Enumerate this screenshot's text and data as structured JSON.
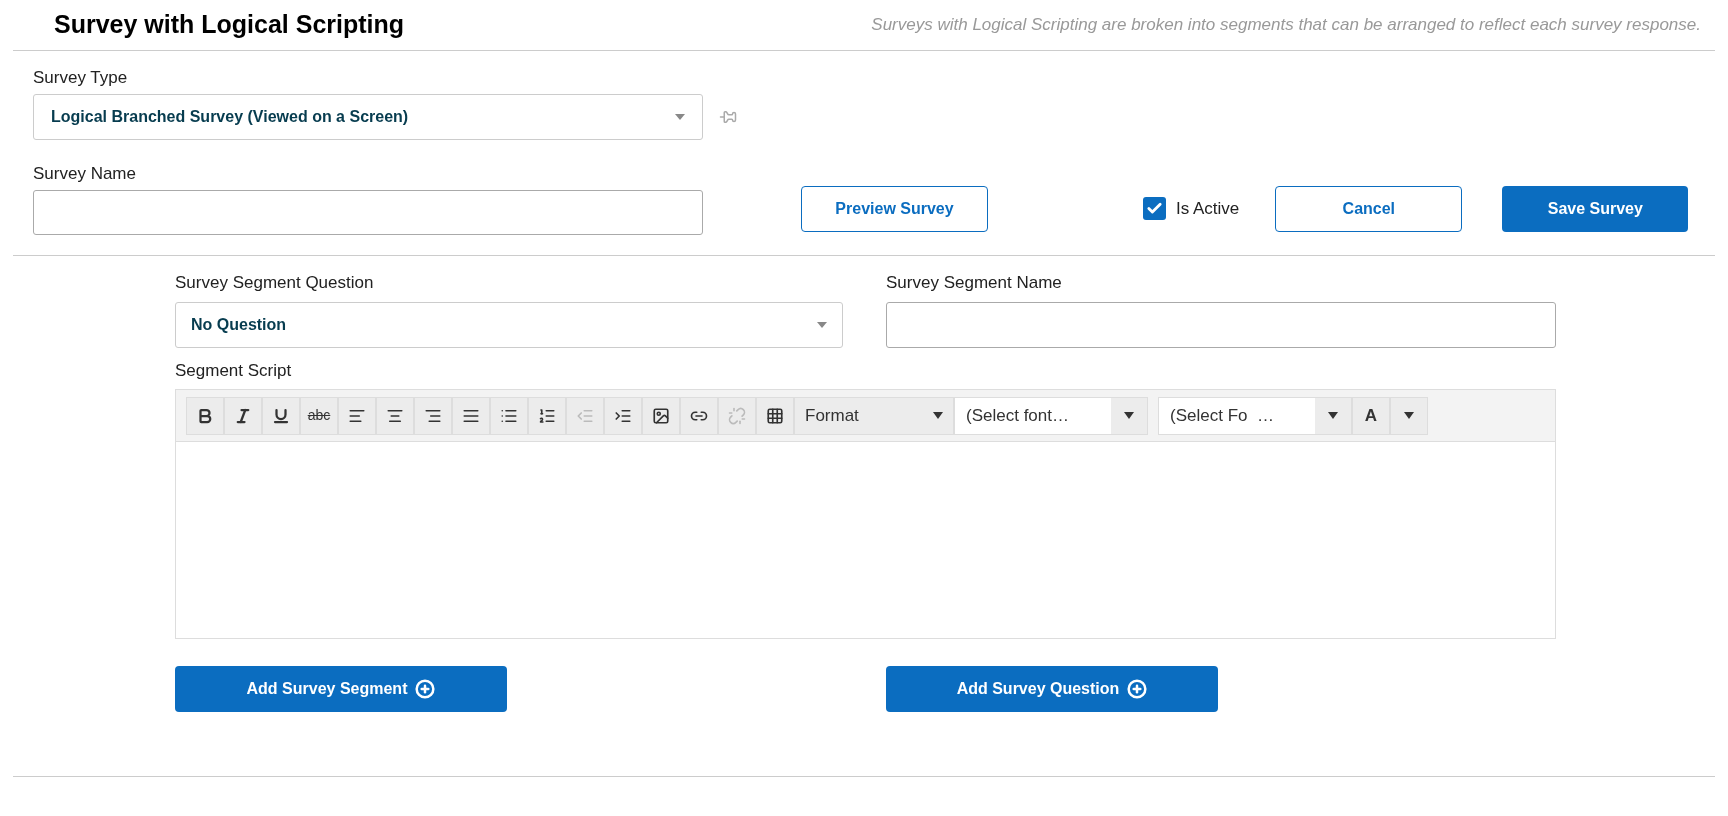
{
  "header": {
    "title": "Survey with Logical Scripting",
    "description": "Surveys with Logical Scripting are broken into segments that can be arranged to reflect each survey response."
  },
  "survey_type": {
    "label": "Survey Type",
    "value": "Logical Branched Survey (Viewed on a Screen)"
  },
  "survey_name": {
    "label": "Survey Name"
  },
  "preview_button": "Preview Survey",
  "is_active": {
    "label": "Is Active",
    "checked": true
  },
  "cancel_button": "Cancel",
  "save_button": "Save Survey",
  "segment_question": {
    "label": "Survey Segment Question",
    "value": "No Question"
  },
  "segment_name": {
    "label": "Survey Segment Name"
  },
  "segment_script": {
    "label": "Segment Script",
    "toolbar_buttons": [
      {
        "kind": "icon",
        "disabled": false
      },
      {
        "kind": "icon",
        "disabled": false
      },
      {
        "kind": "icon",
        "disabled": false
      },
      {
        "kind": "text",
        "label": "abc",
        "disabled": false
      },
      {
        "kind": "icon",
        "disabled": false
      },
      {
        "kind": "icon",
        "disabled": false
      },
      {
        "kind": "icon",
        "disabled": false
      },
      {
        "kind": "icon",
        "disabled": false
      },
      {
        "kind": "icon",
        "disabled": false
      },
      {
        "kind": "icon",
        "disabled": false
      },
      {
        "kind": "icon",
        "disabled": true
      },
      {
        "kind": "icon",
        "disabled": false
      },
      {
        "kind": "icon",
        "disabled": false
      },
      {
        "kind": "icon",
        "disabled": false
      },
      {
        "kind": "icon",
        "disabled": true
      },
      {
        "kind": "icon",
        "disabled": false
      }
    ],
    "dropdowns": [
      {
        "label": "Format",
        "kind": "plain"
      },
      {
        "label": "(Select font…",
        "kind": "field"
      },
      {
        "label": "(Select Fo  …",
        "kind": "field"
      }
    ],
    "color_button": "A"
  },
  "add_segment_button": "Add Survey Segment",
  "add_question_button": "Add Survey Question"
}
